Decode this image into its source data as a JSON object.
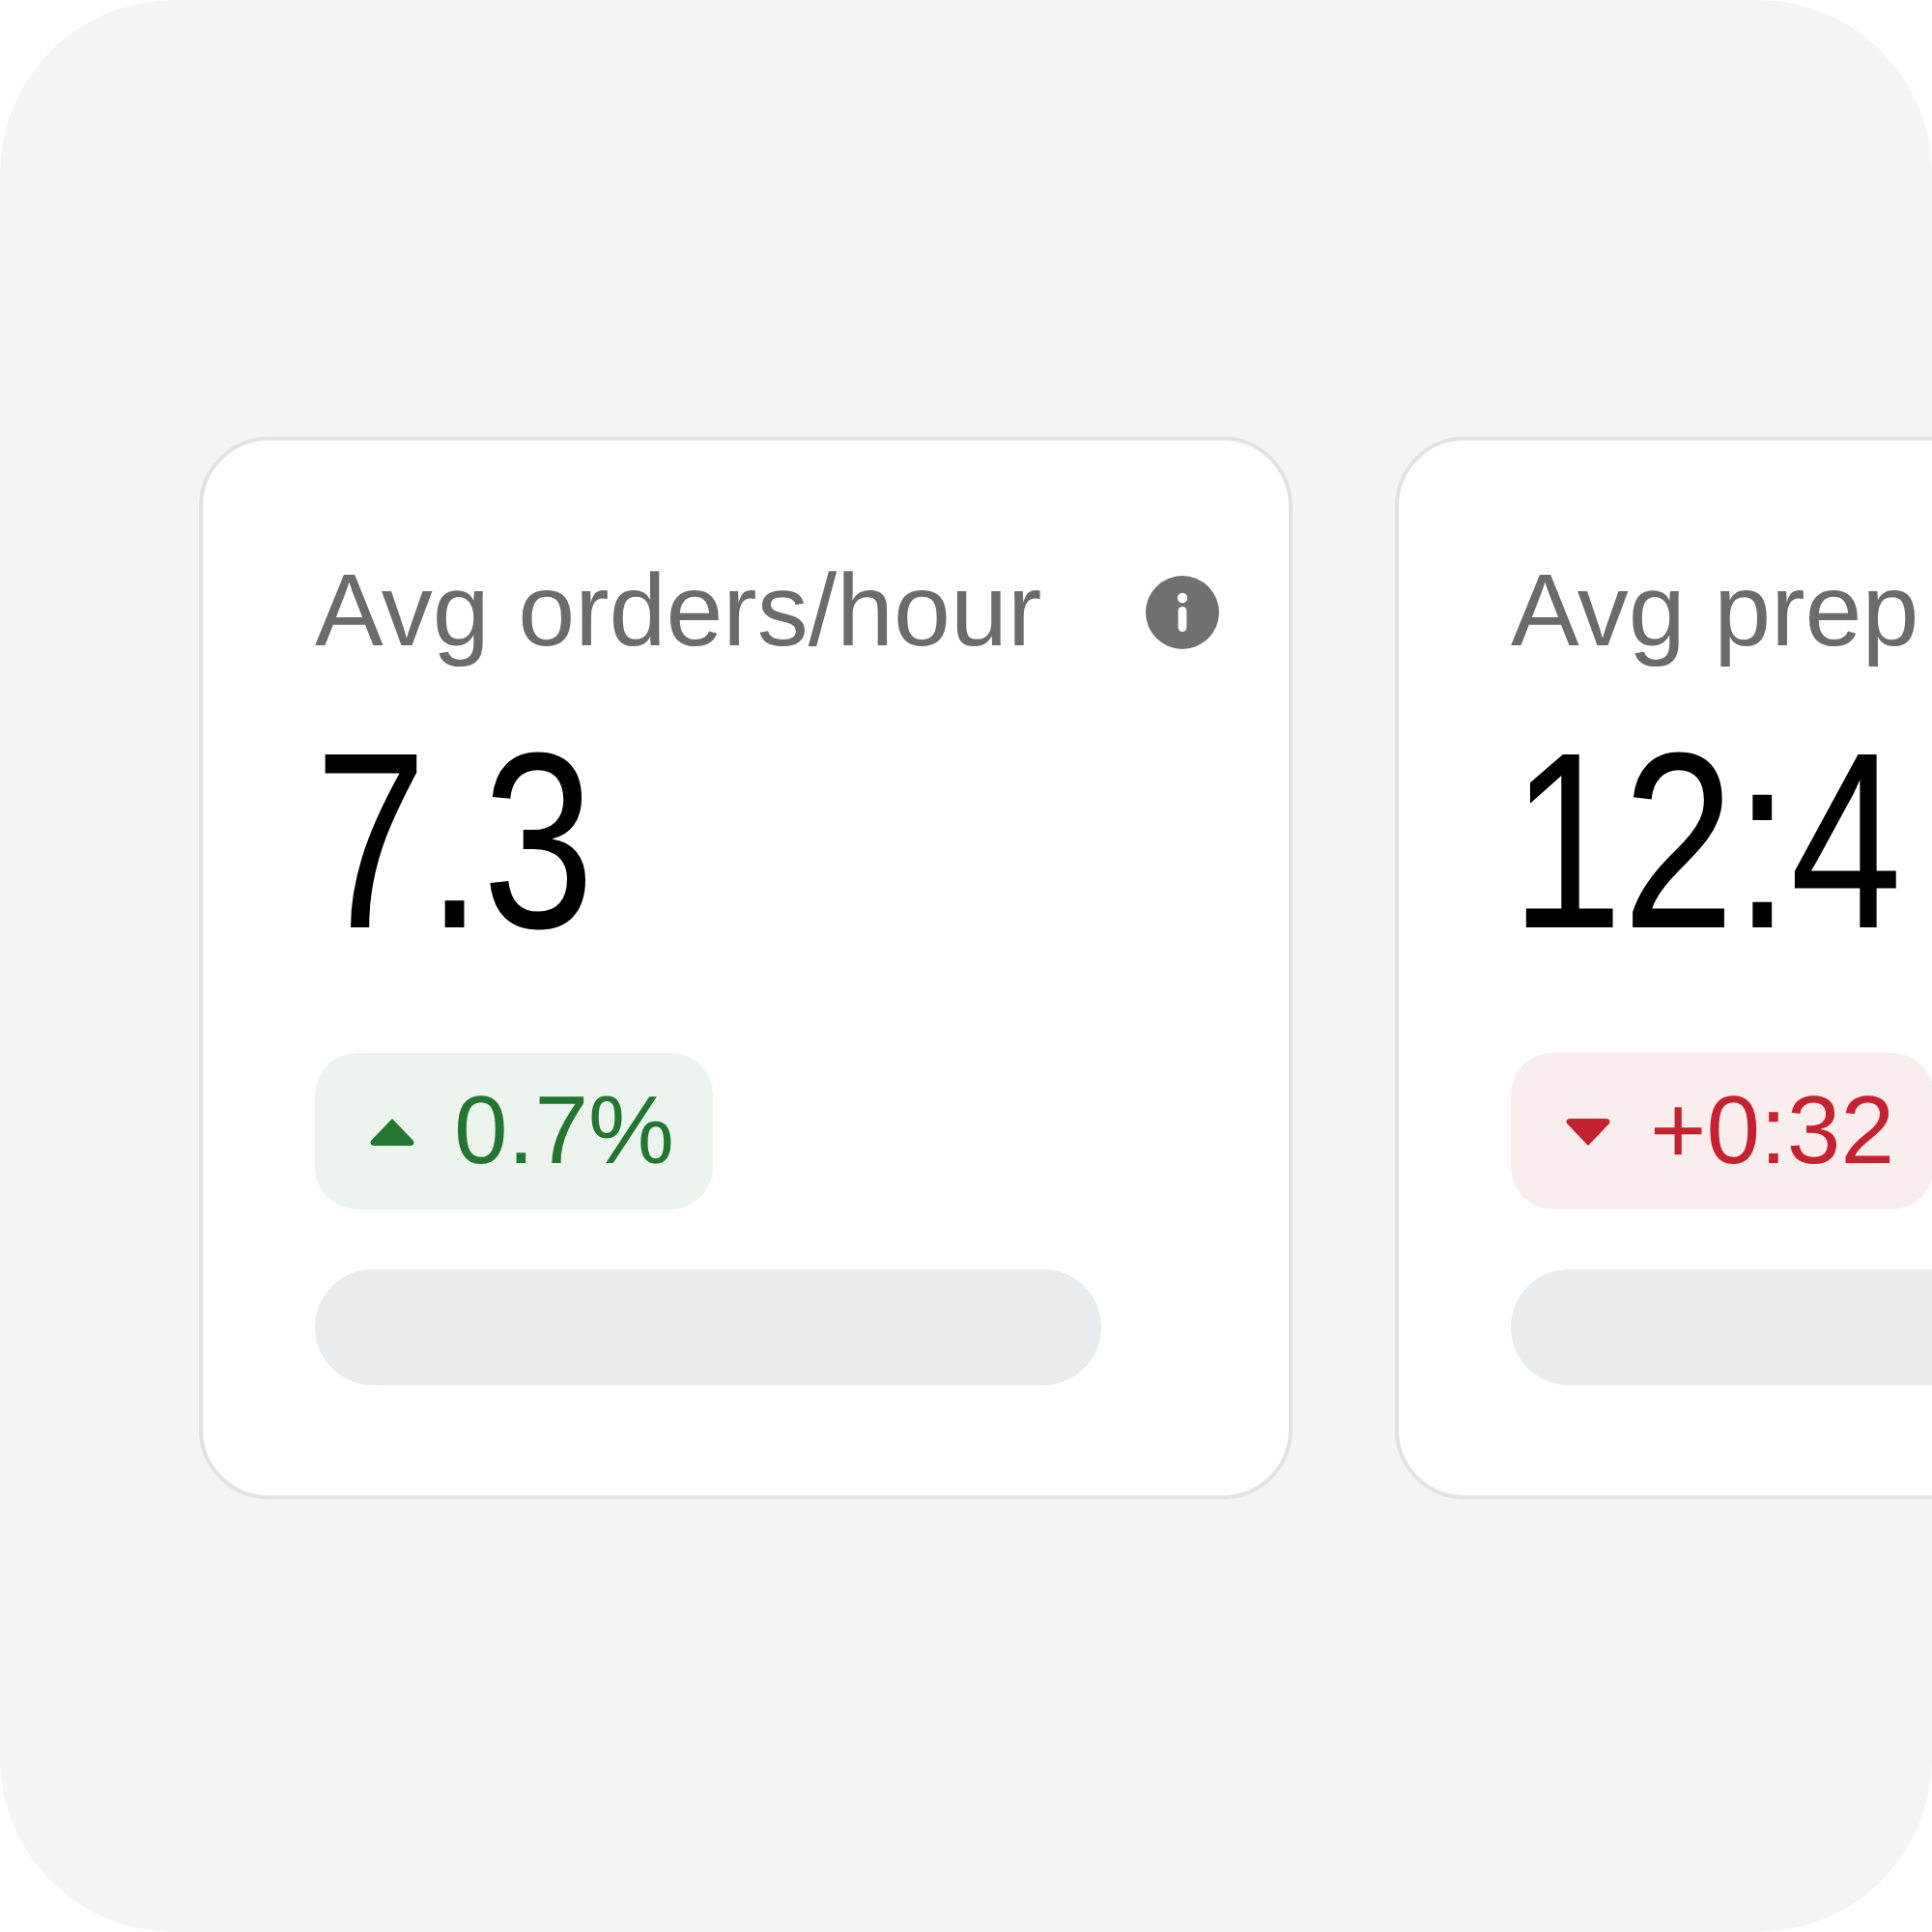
{
  "cards": [
    {
      "title": "Avg orders/hour",
      "info_icon": true,
      "value": "7.3",
      "change": {
        "text": "0.7%",
        "kind": "up",
        "color": "#22762f"
      }
    },
    {
      "title": "Avg prep",
      "value": "12:4",
      "change": {
        "text": "+0:32",
        "kind": "down",
        "color": "#c4222f"
      }
    }
  ]
}
